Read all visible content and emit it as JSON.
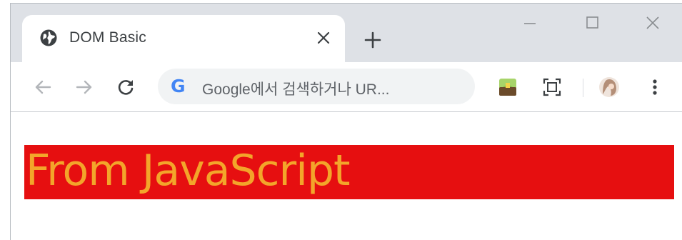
{
  "tab": {
    "title": "DOM Basic",
    "favicon": "globe-icon"
  },
  "toolbar": {
    "omnibox_placeholder": "Google에서 검색하거나 UR..."
  },
  "page": {
    "message": "From JavaScript"
  },
  "colors": {
    "tabstrip": "#dee1e6",
    "omnibox": "#f1f3f4",
    "message_background": "#e60f10",
    "message_text": "#f3a52a"
  }
}
